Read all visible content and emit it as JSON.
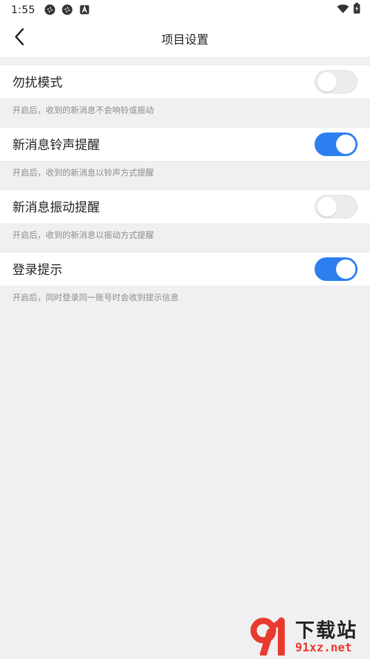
{
  "status_bar": {
    "time": "1:55",
    "icons": [
      "camera-aperture-icon",
      "camera-aperture-icon",
      "font-a-icon"
    ],
    "right_icons": [
      "wifi-icon",
      "battery-charging-icon"
    ]
  },
  "header": {
    "title": "项目设置",
    "back_icon": "chevron-left-icon"
  },
  "settings": [
    {
      "label": "勿扰模式",
      "description": "开启后，收到的新消息不会响铃或振动",
      "enabled": false
    },
    {
      "label": "新消息铃声提醒",
      "description": "开启后，收到的新消息以铃声方式提醒",
      "enabled": true
    },
    {
      "label": "新消息振动提醒",
      "description": "开启后，收到的新消息以振动方式提醒",
      "enabled": false
    },
    {
      "label": "登录提示",
      "description": "开启后，同时登录同一账号时会收到提示信息",
      "enabled": true
    }
  ],
  "colors": {
    "accent": "#2d7ff0",
    "background": "#f0f0f2",
    "row_background": "#ffffff",
    "description_text": "#8c8c8c",
    "watermark_red": "#e83b2e"
  },
  "watermark": {
    "brand": "下载站",
    "url": "91xz.net"
  }
}
